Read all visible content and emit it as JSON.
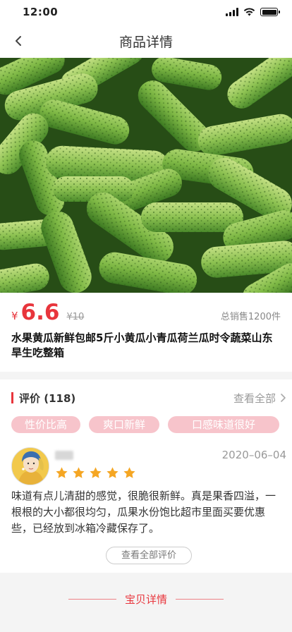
{
  "status": {
    "time": "12:00"
  },
  "nav": {
    "title": "商品详情",
    "back_icon": "chevron-left-icon"
  },
  "product": {
    "currency": "¥",
    "price": "6.6",
    "old_price": "¥10",
    "sold": "总销售1200件",
    "title": "水果黄瓜新鲜包邮5斤小黄瓜小青瓜荷兰瓜时令蔬菜山东旱生吃整箱"
  },
  "reviews": {
    "title": "评价 (118)",
    "view_all": "查看全部",
    "tags": [
      "性价比高",
      "爽口新鲜",
      "口感味道很好"
    ],
    "item": {
      "date": "2020–06–04",
      "stars": 5,
      "text": "味道有点儿清甜的感觉，很脆很新鲜。真是果香四溢，一根根的大小都很均匀，瓜果水份饱比超市里面买要优惠些，已经放到冰箱冷藏保存了。"
    },
    "all_reviews_btn": "查看全部评价"
  },
  "detail": {
    "label": "宝贝详情"
  },
  "colors": {
    "accent": "#e8353c",
    "tag_bg": "#f7c4cb",
    "star": "#f5a623"
  }
}
